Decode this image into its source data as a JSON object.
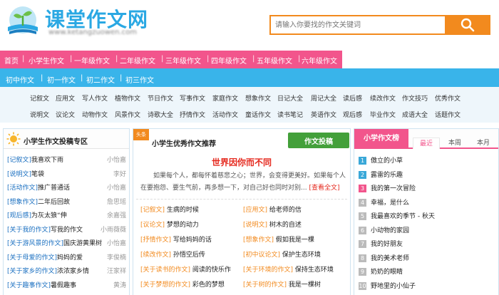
{
  "header": {
    "site_title": "课堂作文网",
    "site_url": "www.ketangzuowen.com",
    "search_placeholder": "请输入你要找的作文关键词"
  },
  "nav_primary": [
    "首页",
    "小学生作文",
    "一年级作文",
    "二年级作文",
    "三年级作文",
    "四年级作文",
    "五年级作文",
    "六年级作文"
  ],
  "nav_secondary": [
    "初中作文",
    "初一作文",
    "初二作文",
    "初三作文"
  ],
  "categories_row1": [
    "记叙文",
    "应用文",
    "写人作文",
    "植物作文",
    "节日作文",
    "写事作文",
    "家庭作文",
    "想象作文",
    "日记大全",
    "周记大全",
    "读后感",
    "续改作文",
    "作文技巧",
    "优秀作文"
  ],
  "categories_row2": [
    "说明文",
    "议论文",
    "动物作文",
    "风景作文",
    "诗歌大全",
    "抒情作文",
    "活动作文",
    "童话作文",
    "读书笔记",
    "英语作文",
    "观后感",
    "毕业作文",
    "成语大全",
    "话题作文"
  ],
  "left_panel": {
    "title": "小学生作文投稿专区",
    "items": [
      {
        "tag": "[记叙文]",
        "title": "我喜欢下雨",
        "author": "小怡嘉"
      },
      {
        "tag": "[说明文]",
        "title": "笔袋",
        "author": "李好"
      },
      {
        "tag": "[活动作文]",
        "title": "推广普通话",
        "author": "小怡嘉"
      },
      {
        "tag": "[想象作文]",
        "title": "二年后回故",
        "author": "詹思瑶"
      },
      {
        "tag": "[观后感]",
        "title": "为灰太狼“伸",
        "author": "余嘉强"
      },
      {
        "tag": "[关于我的作文]",
        "title": "写我的作文",
        "author": "小雨薇薇"
      },
      {
        "tag": "[关于游风景的作文]",
        "title": "国庆游黄果树",
        "author": "小怡嘉"
      },
      {
        "tag": "[关于母爱的作文]",
        "title": "妈妈的爱",
        "author": "李俊楠"
      },
      {
        "tag": "[关于家乡的作文]",
        "title": "浓浓家乡情",
        "author": "汪家祥"
      },
      {
        "tag": "[关于趣事作文]",
        "title": "暑假趣事",
        "author": "黄涛"
      }
    ]
  },
  "middle_panel": {
    "ribbon": "头条",
    "title": "小学生优秀作文推荐",
    "submit_label": "作文投稿",
    "feature_title": "世界因你而不同",
    "feature_text": "如果每个人，都每怀着慈悲之心；世界，会变得更美好。如果每个人在要抱怨、要生气前，再多想一下，对自己好也同时对别...",
    "feature_more": "[查看全文]",
    "items_left": [
      {
        "tag": "[记叙文]",
        "title": "生病的时候"
      },
      {
        "tag": "[议论文]",
        "title": "梦想的动力"
      },
      {
        "tag": "[抒情作文]",
        "title": "写给妈妈的话"
      },
      {
        "tag": "[续改作文]",
        "title": "孙悟空后传"
      },
      {
        "tag": "[关于读书的作文]",
        "title": "阅读的快乐作"
      },
      {
        "tag": "[关于梦想的作文]",
        "title": "彩色的梦想"
      }
    ],
    "items_right": [
      {
        "tag": "[应用文]",
        "title": "给老师的信"
      },
      {
        "tag": "[说明文]",
        "title": "树木的自述"
      },
      {
        "tag": "[想象作文]",
        "title": "假如我是一棵"
      },
      {
        "tag": "[初中议论文]",
        "title": "保护生态环境"
      },
      {
        "tag": "[关于环境的作文]",
        "title": "保持生态环境"
      },
      {
        "tag": "[关于树的作文]",
        "title": "我是一棵树"
      }
    ]
  },
  "right_panel": {
    "title": "小学作文榜",
    "tabs": [
      "最近",
      "本周",
      "本月"
    ],
    "items": [
      "傲立的小草",
      "露雷的乐趣",
      "我的第一次冒险",
      "幸福，是什么",
      "我最喜欢的季节 - 秋天",
      "小动物的家园",
      "我的好朋友",
      "我的美术老师",
      "奶奶的眼睛",
      "野地里的小仙子"
    ],
    "rank_colors": [
      "#3aa8d8",
      "#3aa8d8",
      "#f2558c",
      "#bbbbbb",
      "#bbbbbb",
      "#bbbbbb",
      "#bbbbbb",
      "#bbbbbb",
      "#bbbbbb",
      "#bbbbbb"
    ]
  }
}
